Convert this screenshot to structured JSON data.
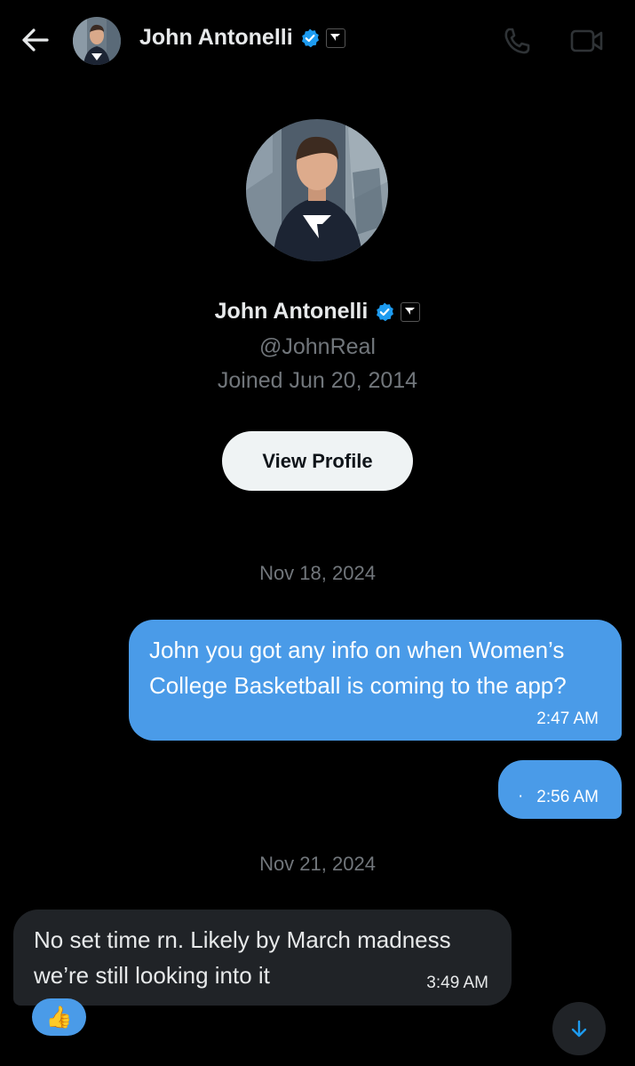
{
  "header": {
    "title": "John Antonelli",
    "icons": {
      "back": "arrow-left-icon",
      "verified": "verified-badge-icon",
      "affiliation": "affiliate-logo-icon",
      "call": "phone-icon",
      "video": "video-camera-icon"
    }
  },
  "profile": {
    "name": "John Antonelli",
    "handle": "@JohnReal",
    "joined": "Joined Jun 20, 2014",
    "view_profile_label": "View Profile"
  },
  "conversation": {
    "date_1": "Nov 18, 2024",
    "msg_1": {
      "line1": "John you got any info on when Women’s",
      "line2": "College Basketball is coming to the app?",
      "time": "2:47 AM"
    },
    "msg_2": {
      "dot": "·",
      "time": "2:56 AM"
    },
    "date_2": "Nov 21, 2024",
    "msg_3": {
      "line1": "No set time rn. Likely by March madness",
      "line2": "we’re still looking into it",
      "time": "3:49 AM"
    },
    "reaction": "👍"
  },
  "colors": {
    "background": "#000000",
    "outgoing_bubble": "#4a9be8",
    "incoming_bubble": "#202327",
    "muted_text": "#71767b",
    "verified_blue": "#1d9bf0"
  }
}
